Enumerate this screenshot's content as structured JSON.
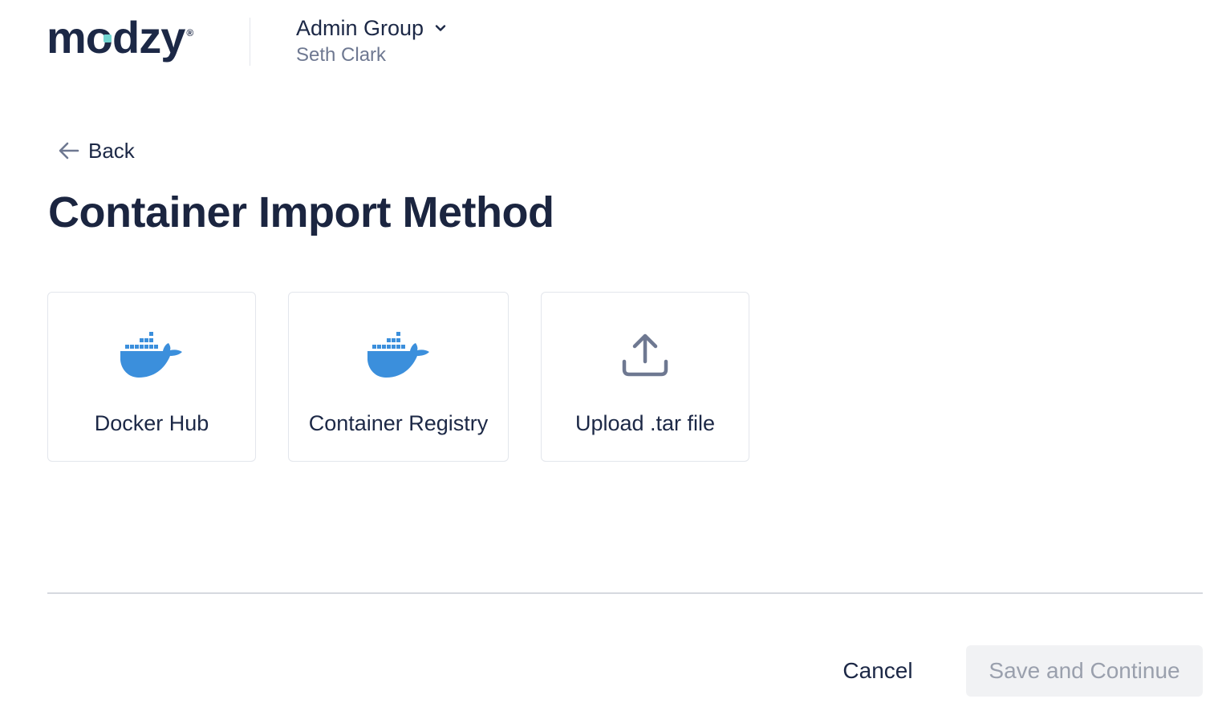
{
  "header": {
    "logo_text": "modzy",
    "logo_mark": "®",
    "group_name": "Admin Group",
    "user_name": "Seth Clark"
  },
  "nav": {
    "back_label": "Back"
  },
  "page": {
    "title": "Container Import Method"
  },
  "methods": [
    {
      "label": "Docker Hub",
      "icon": "docker-whale-icon"
    },
    {
      "label": "Container Registry",
      "icon": "docker-whale-icon"
    },
    {
      "label": "Upload .tar file",
      "icon": "upload-icon"
    }
  ],
  "footer": {
    "cancel_label": "Cancel",
    "save_label": "Save and Continue"
  },
  "colors": {
    "brand_navy": "#1c2846",
    "docker_blue": "#3b8fdc",
    "teal_accent": "#71d4d0",
    "muted_text": "#6e7891",
    "disabled_text": "#9aa0ad",
    "disabled_bg": "#f1f2f4"
  }
}
